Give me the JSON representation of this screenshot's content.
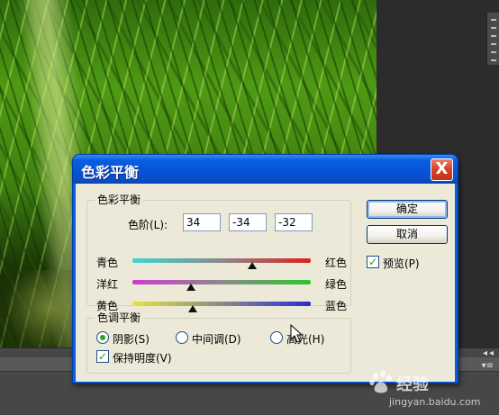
{
  "dialog": {
    "title": "色彩平衡",
    "close_label": "X",
    "color_balance_group": {
      "legend": "色彩平衡",
      "levels_label": "色阶(L):",
      "levels": [
        "34",
        "-34",
        "-32"
      ],
      "sliders": [
        {
          "left": "青色",
          "right": "红色",
          "value": 34,
          "left_color": "#3ed5d5",
          "right_color": "#e02020"
        },
        {
          "left": "洋红",
          "right": "绿色",
          "value": -34,
          "left_color": "#d33ad3",
          "right_color": "#2fc42f"
        },
        {
          "left": "黄色",
          "right": "蓝色",
          "value": -32,
          "left_color": "#e4e43a",
          "right_color": "#2a2ad8"
        }
      ],
      "slider_range": [
        -100,
        100
      ]
    },
    "tone_balance_group": {
      "legend": "色调平衡",
      "options": [
        {
          "label": "阴影(S)",
          "selected": true
        },
        {
          "label": "中间调(D)",
          "selected": false
        },
        {
          "label": "高光(H)",
          "selected": false
        }
      ],
      "preserve_luminosity_label": "保持明度(V)",
      "preserve_luminosity_checked": true
    },
    "buttons": {
      "ok": "确定",
      "cancel": "取消"
    },
    "preview_label": "预览(P)",
    "preview_checked": true
  },
  "watermark": {
    "text": "经验",
    "url": "jingyan.baidu.com"
  },
  "icons": [
    "close-icon",
    "mouse-cursor-icon",
    "panel-collapse-icon",
    "panel-menu-icon",
    "baidu-paw-icon"
  ]
}
